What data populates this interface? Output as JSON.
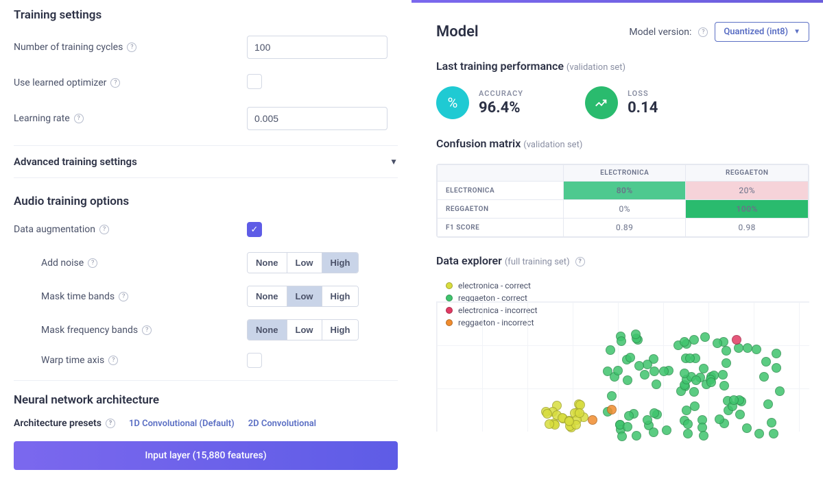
{
  "training": {
    "title": "Training settings",
    "cycles_label": "Number of training cycles",
    "cycles_value": "100",
    "use_lopt_label": "Use learned optimizer",
    "lr_label": "Learning rate",
    "lr_value": "0.005",
    "advanced_title": "Advanced training settings"
  },
  "audio": {
    "title": "Audio training options",
    "augmentation_label": "Data augmentation",
    "noise_label": "Add noise",
    "mask_time_label": "Mask time bands",
    "mask_freq_label": "Mask frequency bands",
    "warp_label": "Warp time axis",
    "opts": {
      "none": "None",
      "low": "Low",
      "high": "High"
    }
  },
  "arch": {
    "title": "Neural network architecture",
    "presets_label": "Architecture presets",
    "preset1": "1D Convolutional (Default)",
    "preset2": "2D Convolutional",
    "input_layer": "Input layer (15,880 features)"
  },
  "model": {
    "title": "Model",
    "version_label": "Model version:",
    "version_value": "Quantized (int8)",
    "perf_title": "Last training performance",
    "perf_sub": "(validation set)",
    "accuracy_label": "ACCURACY",
    "accuracy_value": "96.4%",
    "loss_label": "LOSS",
    "loss_value": "0.14",
    "confusion_title": "Confusion matrix",
    "confusion_sub": "(validation set)",
    "confusion": {
      "col1": "ELECTRONICA",
      "col2": "REGGAETON",
      "row1": "ELECTRONICA",
      "row2": "REGGAETON",
      "row3": "F1 SCORE",
      "c11": "80%",
      "c12": "20%",
      "c21": "0%",
      "c22": "100%",
      "c31": "0.89",
      "c32": "0.98"
    },
    "explorer_title": "Data explorer",
    "explorer_sub": "(full training set)",
    "legend": {
      "l1": "electronica - correct",
      "l2": "reggaeton - correct",
      "l3": "electronica - incorrect",
      "l4": "reggaeton - incorrect"
    }
  },
  "chart_data": {
    "type": "scatter",
    "title": "Data explorer (full training set)",
    "xlabel": "",
    "ylabel": "",
    "series": [
      {
        "name": "electronica - correct",
        "color": "#d8dd3e",
        "count": 22
      },
      {
        "name": "reggaeton - correct",
        "color": "#3fc46d",
        "count": 95
      },
      {
        "name": "electronica - incorrect",
        "color": "#e13a63",
        "count": 1
      },
      {
        "name": "reggaeton - incorrect",
        "color": "#f08c2e",
        "count": 2
      }
    ]
  }
}
